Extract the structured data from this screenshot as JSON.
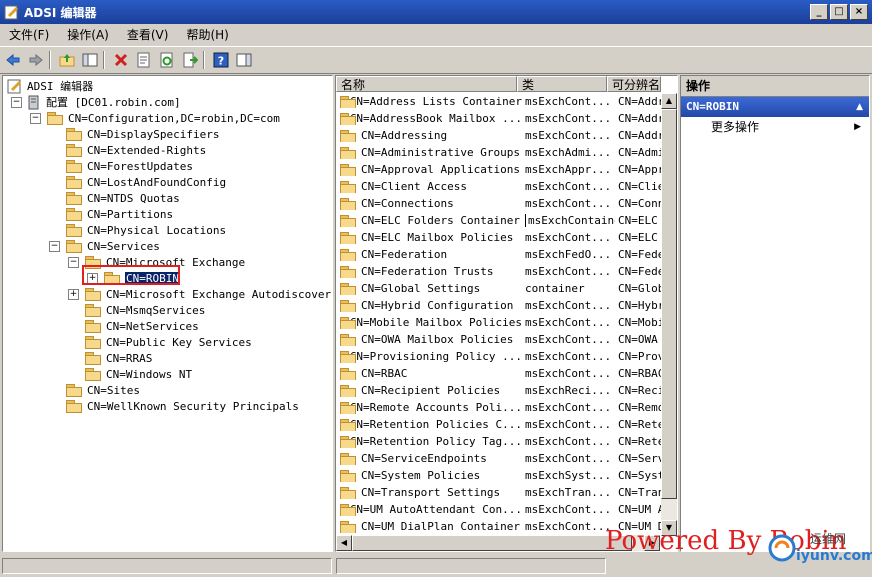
{
  "window": {
    "title": "ADSI 编辑器",
    "buttons": [
      "_",
      "□",
      "×"
    ]
  },
  "menu": [
    "文件(F)",
    "操作(A)",
    "查看(V)",
    "帮助(H)"
  ],
  "toolbar": [
    "back-icon",
    "forward-icon",
    "up-folder-icon",
    "show-tree-icon",
    "delete-icon",
    "properties-icon",
    "refresh-icon",
    "export-icon",
    "help-icon",
    "show-action-pane-icon"
  ],
  "tree": {
    "nodes": [
      {
        "label": "ADSI 编辑器",
        "depth": 0,
        "expander": "none",
        "icon": "adsi-icon"
      },
      {
        "label": "配置 [DC01.robin.com]",
        "depth": 0,
        "expander": "-",
        "icon": "server-icon"
      },
      {
        "label": "CN=Configuration,DC=robin,DC=com",
        "depth": 1,
        "expander": "-",
        "icon": "folder-icon"
      },
      {
        "label": "CN=DisplaySpecifiers",
        "depth": 2,
        "expander": "none",
        "icon": "folder-icon"
      },
      {
        "label": "CN=Extended-Rights",
        "depth": 2,
        "expander": "none",
        "icon": "folder-icon"
      },
      {
        "label": "CN=ForestUpdates",
        "depth": 2,
        "expander": "none",
        "icon": "folder-icon"
      },
      {
        "label": "CN=LostAndFoundConfig",
        "depth": 2,
        "expander": "none",
        "icon": "folder-icon"
      },
      {
        "label": "CN=NTDS Quotas",
        "depth": 2,
        "expander": "none",
        "icon": "folder-icon"
      },
      {
        "label": "CN=Partitions",
        "depth": 2,
        "expander": "none",
        "icon": "folder-icon"
      },
      {
        "label": "CN=Physical Locations",
        "depth": 2,
        "expander": "none",
        "icon": "folder-icon"
      },
      {
        "label": "CN=Services",
        "depth": 2,
        "expander": "-",
        "icon": "folder-icon"
      },
      {
        "label": "CN=Microsoft Exchange",
        "depth": 3,
        "expander": "-",
        "icon": "folder-icon"
      },
      {
        "label": "CN=ROBIN",
        "depth": 4,
        "expander": "+",
        "icon": "folder-icon",
        "selected": true
      },
      {
        "label": "CN=Microsoft Exchange Autodiscover",
        "depth": 3,
        "expander": "+",
        "icon": "folder-icon"
      },
      {
        "label": "CN=MsmqServices",
        "depth": 3,
        "expander": "none",
        "icon": "folder-icon"
      },
      {
        "label": "CN=NetServices",
        "depth": 3,
        "expander": "none",
        "icon": "folder-icon"
      },
      {
        "label": "CN=Public Key Services",
        "depth": 3,
        "expander": "none",
        "icon": "folder-icon"
      },
      {
        "label": "CN=RRAS",
        "depth": 3,
        "expander": "none",
        "icon": "folder-icon"
      },
      {
        "label": "CN=Windows NT",
        "depth": 3,
        "expander": "none",
        "icon": "folder-icon"
      },
      {
        "label": "CN=Sites",
        "depth": 2,
        "expander": "none",
        "icon": "folder-icon"
      },
      {
        "label": "CN=WellKnown Security Principals",
        "depth": 2,
        "expander": "none",
        "icon": "folder-icon"
      }
    ]
  },
  "list": {
    "columns": [
      "名称",
      "类",
      "可分辨名"
    ],
    "rows": [
      [
        "CN=Address Lists Container",
        "msExchCont...",
        "CN=Addre"
      ],
      [
        "CN=AddressBook Mailbox ...",
        "msExchCont...",
        "CN=Addre"
      ],
      [
        "CN=Addressing",
        "msExchCont...",
        "CN=Addre"
      ],
      [
        "CN=Administrative Groups",
        "msExchAdmi...",
        "CN=Admir"
      ],
      [
        "CN=Approval Applications",
        "msExchAppr...",
        "CN=Appro"
      ],
      [
        "CN=Client Access",
        "msExchCont...",
        "CN=Clier"
      ],
      [
        "CN=Connections",
        "msExchCont...",
        "CN=Conne"
      ],
      [
        "CN=ELC Folders Container",
        "msExchContainer",
        "CN=ELC F"
      ],
      [
        "CN=ELC Mailbox Policies",
        "msExchCont...",
        "CN=ELC M"
      ],
      [
        "CN=Federation",
        "msExchFedO...",
        "CN=Feder"
      ],
      [
        "CN=Federation Trusts",
        "msExchCont...",
        "CN=Feder"
      ],
      [
        "CN=Global Settings",
        "container",
        "CN=Globa"
      ],
      [
        "CN=Hybrid Configuration",
        "msExchCont...",
        "CN=Hybri"
      ],
      [
        "CN=Mobile Mailbox Policies",
        "msExchCont...",
        "CN=Mobil"
      ],
      [
        "CN=OWA Mailbox Policies",
        "msExchCont...",
        "CN=OWA M"
      ],
      [
        "CN=Provisioning Policy ...",
        "msExchCont...",
        "CN=Provi"
      ],
      [
        "CN=RBAC",
        "msExchCont...",
        "CN=RBAC,"
      ],
      [
        "CN=Recipient Policies",
        "msExchReci...",
        "CN=Recip"
      ],
      [
        "CN=Remote Accounts Poli...",
        "msExchCont...",
        "CN=Remot"
      ],
      [
        "CN=Retention Policies C...",
        "msExchCont...",
        "CN=Reter"
      ],
      [
        "CN=Retention Policy Tag...",
        "msExchCont...",
        "CN=Reter"
      ],
      [
        "CN=ServiceEndpoints",
        "msExchCont...",
        "CN=Servi"
      ],
      [
        "CN=System Policies",
        "msExchSyst...",
        "CN=Syste"
      ],
      [
        "CN=Transport Settings",
        "msExchTran...",
        "CN=Trans"
      ],
      [
        "CN=UM AutoAttendant Con...",
        "msExchCont...",
        "CN=UM Au"
      ],
      [
        "CN=UM DialPlan Container",
        "msExchCont...",
        "CN=UM Di"
      ]
    ]
  },
  "actions": {
    "header": "操作",
    "section": "CN=ROBIN",
    "items": [
      "更多操作"
    ]
  },
  "watermark": "Powered By Robin",
  "logo_text": "iyunv.com",
  "logo_sub": "运维网",
  "colors": {
    "title_bar": "#1b3f9a",
    "selection": "#0a246a",
    "highlight_box": "#e02020",
    "folder": "#f6d98a"
  }
}
